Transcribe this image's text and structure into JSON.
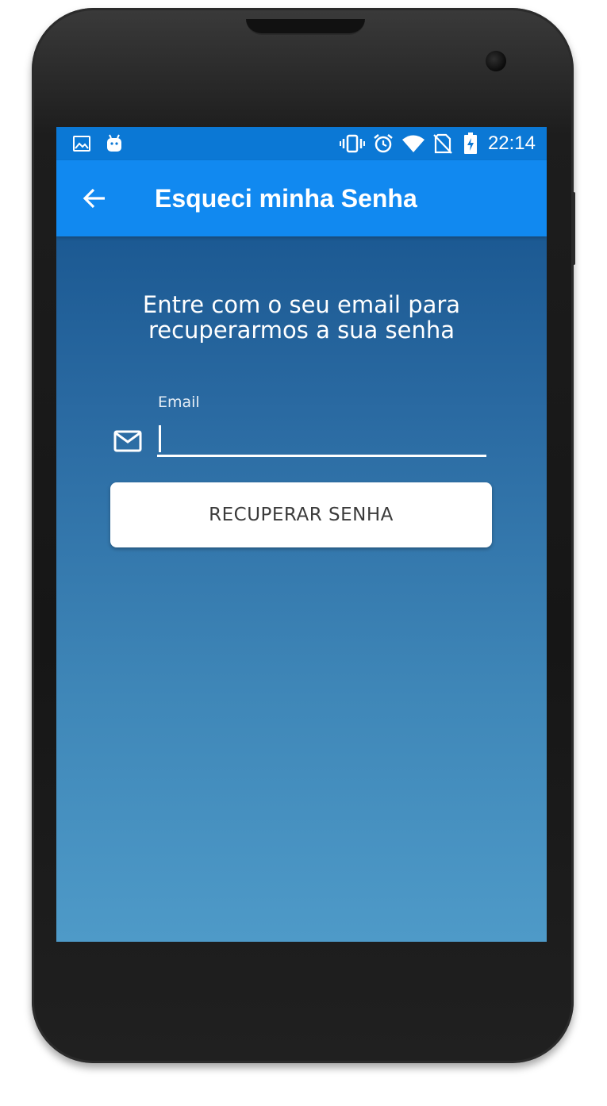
{
  "status_bar": {
    "time": "22:14",
    "icons_left": [
      "image-icon",
      "android-icon"
    ],
    "icons_right": [
      "vibrate-icon",
      "alarm-icon",
      "wifi-icon",
      "no-sim-icon",
      "battery-charging-icon"
    ]
  },
  "app_bar": {
    "title": "Esqueci minha Senha",
    "back_icon": "arrow-back-icon"
  },
  "form": {
    "instructions_line1": "Entre com o seu email para",
    "instructions_line2": "recuperarmos a sua senha",
    "email_label": "Email",
    "email_value": "",
    "email_icon": "mail-icon",
    "submit_label": "RECUPERAR SENHA"
  },
  "colors": {
    "status_bar": "#0b78d5",
    "app_bar": "#1189f0",
    "background_top": "#134f89",
    "background_bottom": "#4e9ac8",
    "button": "#ffffff",
    "button_text": "#3b3b3b"
  }
}
